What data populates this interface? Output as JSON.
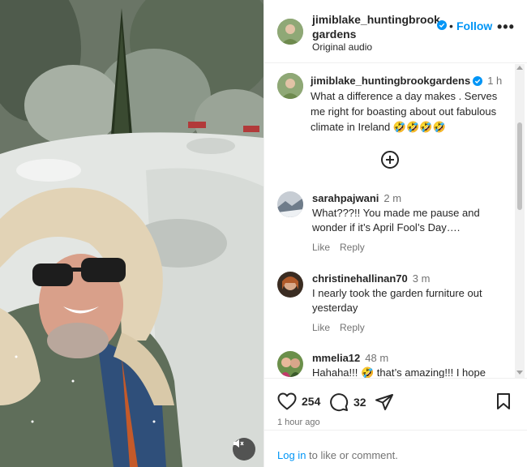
{
  "post": {
    "author": "jimiblake_huntingbrook gardens",
    "follow_separator": "•",
    "follow_label": "Follow",
    "more_label": "•••",
    "audio": "Original audio"
  },
  "caption": {
    "username": "jimiblake_huntingbrookgardens",
    "time": "1 h",
    "text": "What a difference a day makes . Serves me right for boasting about out fabulous climate in Ireland 🤣🤣🤣🤣"
  },
  "comments": [
    {
      "username": "sarahpajwani",
      "time": "2 m",
      "text": "What???!! You made me pause and wonder if it’s April Fool’s Day….",
      "like_label": "Like",
      "reply_label": "Reply"
    },
    {
      "username": "christinehallinan70",
      "time": "3 m",
      "text": "I nearly took the garden furniture out yesterday",
      "like_label": "Like",
      "reply_label": "Reply"
    },
    {
      "username": "mmelia12",
      "time": "48 m",
      "text": "Hahaha!!! 🤣 that’s amazing!!! I hope"
    }
  ],
  "actions": {
    "likes": "254",
    "comments": "32",
    "time_ago": "1 hour ago"
  },
  "login": {
    "link": "Log in",
    "rest": " to like or comment."
  },
  "colors": {
    "accent": "#0095f6",
    "muted": "#737373",
    "text": "#262626"
  }
}
